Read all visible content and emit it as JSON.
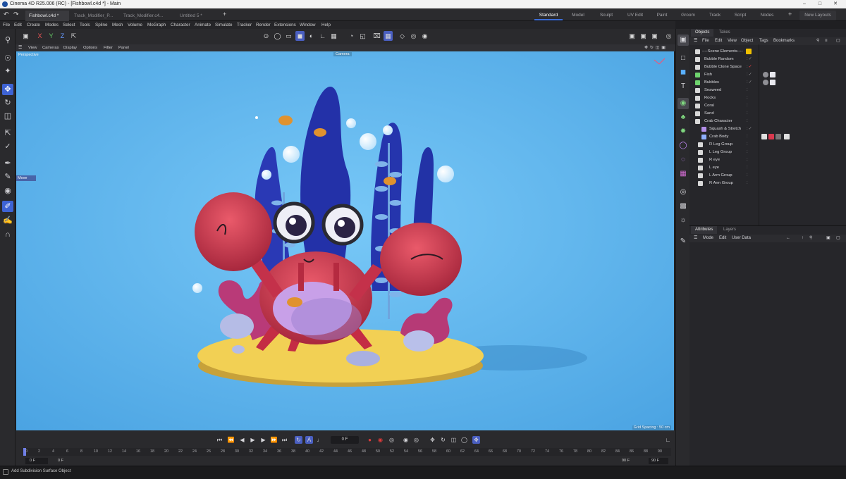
{
  "window": {
    "title": "Cinema 4D R25.006 (RC) - [Fishbowl.c4d *] - Main"
  },
  "doc_tabs": [
    "Fishbowl.c4d *",
    "Track_Modifier_P...",
    "Track_Modifier.c4...",
    "Untitled 5 *"
  ],
  "layouts": [
    "Standard",
    "Model",
    "Sculpt",
    "UV Edit",
    "Paint",
    "Groom",
    "Track",
    "Script",
    "Nodes"
  ],
  "layouts_active": "Standard",
  "new_layouts_label": "New Layouts",
  "menu": [
    "File",
    "Edit",
    "Create",
    "Modes",
    "Select",
    "Tools",
    "Spline",
    "Mesh",
    "Volume",
    "MoGraph",
    "Character",
    "Animate",
    "Simulate",
    "Tracker",
    "Render",
    "Extensions",
    "Window",
    "Help"
  ],
  "axis_lock": [
    "X",
    "Y",
    "Z"
  ],
  "viewport": {
    "menu": [
      "View",
      "Cameras",
      "Display",
      "Options",
      "Filter",
      "Panel"
    ],
    "projection": "Perspective",
    "camera": "Camera",
    "grid_spacing": "Grid Spacing : 50 cm",
    "tooltip": "Move"
  },
  "objects_panel": {
    "tabs": [
      "Objects",
      "Takes"
    ],
    "menu": [
      "File",
      "Edit",
      "View",
      "Object",
      "Tags",
      "Bookmarks"
    ],
    "items": [
      {
        "name": "----Scene Elements----",
        "indent": 0
      },
      {
        "name": "Bubble Random",
        "indent": 0
      },
      {
        "name": "Bubble Clone Space",
        "indent": 0
      },
      {
        "name": "Fish",
        "indent": 0
      },
      {
        "name": "Bubbles",
        "indent": 0
      },
      {
        "name": "Seaweed",
        "indent": 0
      },
      {
        "name": "Rocks",
        "indent": 0
      },
      {
        "name": "Coral",
        "indent": 0
      },
      {
        "name": "Sand",
        "indent": 0
      },
      {
        "name": "Crab Character",
        "indent": 0
      },
      {
        "name": "Squash & Stretch",
        "indent": 1
      },
      {
        "name": "Crab Body",
        "indent": 1
      },
      {
        "name": "R Leg Group",
        "indent": 1
      },
      {
        "name": "L Leg Group",
        "indent": 1
      },
      {
        "name": "R eye",
        "indent": 1
      },
      {
        "name": "L eye",
        "indent": 1
      },
      {
        "name": "L Arm Group",
        "indent": 1
      },
      {
        "name": "R Arm Group",
        "indent": 1
      }
    ]
  },
  "attributes_panel": {
    "tabs": [
      "Attributes",
      "Layers"
    ],
    "menu": [
      "Mode",
      "Edit",
      "User Data"
    ]
  },
  "timeline": {
    "current_frame": "0 F",
    "start_field": "0 F",
    "start_field2": "0 F",
    "end_field": "90 F",
    "end_field2": "90 F",
    "ticks": [
      "0",
      "2",
      "4",
      "6",
      "8",
      "10",
      "12",
      "14",
      "16",
      "18",
      "20",
      "22",
      "24",
      "26",
      "28",
      "30",
      "32",
      "34",
      "36",
      "38",
      "40",
      "42",
      "44",
      "46",
      "48",
      "50",
      "52",
      "54",
      "56",
      "58",
      "60",
      "62",
      "64",
      "66",
      "68",
      "70",
      "72",
      "74",
      "76",
      "78",
      "80",
      "82",
      "84",
      "86",
      "88",
      "90"
    ]
  },
  "status": "Add Subdivision Surface Object",
  "colors": {
    "accent": "#3d6fd8",
    "viewport_bg": "#5fb5ee",
    "crab": "#d9394e",
    "sand": "#f2d054",
    "seaweed": "#2431a8"
  }
}
